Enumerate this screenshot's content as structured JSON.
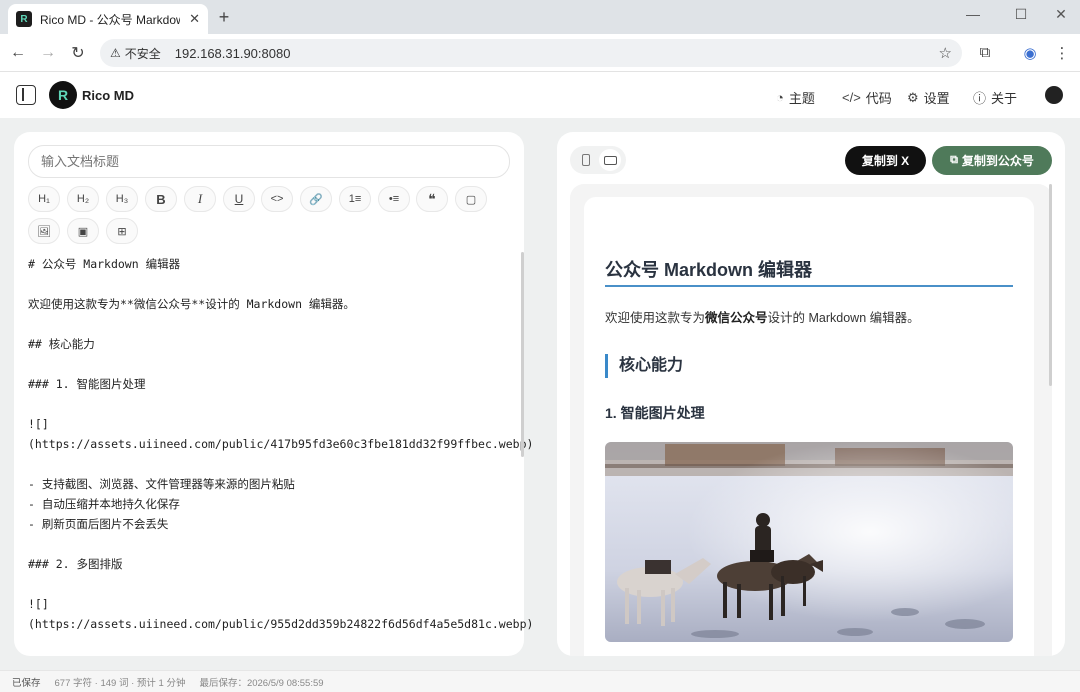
{
  "browser": {
    "tab_title": "Rico MD - 公众号 Markdown",
    "tab_close": "✕",
    "new_tab": "+",
    "favicon_text": "R",
    "insecure_label": "不安全",
    "url": "192.168.31.90:8080"
  },
  "app": {
    "brand": "Rico MD",
    "logo_text": "R",
    "nav": [
      {
        "label": "主题",
        "icon": "palette-icon"
      },
      {
        "label": "代码",
        "icon": "code-icon"
      },
      {
        "label": "设置",
        "icon": "sliders-icon"
      },
      {
        "label": "关于",
        "icon": "info-icon"
      }
    ]
  },
  "editor": {
    "title_placeholder": "输入文档标题",
    "toolbar": [
      "H1",
      "H2",
      "H3",
      "B",
      "I",
      "U",
      "<>",
      "link",
      "ol",
      "ul",
      "quote",
      "file",
      "image",
      "gallery",
      "table"
    ],
    "toolbar_text": {
      "h1": "H₁",
      "h2": "H₂",
      "h3": "H₃",
      "bold": "B",
      "italic": "I",
      "underline": "U",
      "code": "<>",
      "link": "🔗",
      "ordered_list": "1≡",
      "bullet_list": "•≡",
      "quote": "❝",
      "file": "▢",
      "image": "🖼",
      "gallery": "▣",
      "table": "⊞"
    },
    "lines": [
      "# 公众号 Markdown 编辑器",
      "",
      "欢迎使用这款专为**微信公众号**设计的 Markdown 编辑器。",
      "",
      "## 核心能力",
      "",
      "### 1. 智能图片处理",
      "",
      "![]",
      "(https://assets.uiineed.com/public/417b95fd3e60c3fbe181dd32f99ffbec.webp)",
      "",
      "- 支持截图、浏览器、文件管理器等来源的图片粘贴",
      "- 自动压缩并本地持久化保存",
      "- 刷新页面后图片不会丢失",
      "",
      "### 2. 多图排版",
      "",
      "![]",
      "(https://assets.uiineed.com/public/955d2dd359b24822f6d56df4a5e5d81c.webp)"
    ]
  },
  "preview": {
    "copy_x": "复制到 X",
    "copy_wechat": "复制到公众号",
    "h1": "公众号 Markdown 编辑器",
    "p_before": "欢迎使用这款专为",
    "p_bold": "微信公众号",
    "p_after": "设计的 Markdown 编辑器。",
    "h2": "核心能力",
    "h3": "1. 智能图片处理"
  },
  "status": {
    "saved": "已保存",
    "stats": "677 字符 · 149 词 · 预计 1 分钟",
    "last_saved": "最后保存：2026/5/9 08:55:59"
  },
  "colors": {
    "accent_green": "#4f7a5a",
    "heading_blue": "#3a89c9"
  }
}
